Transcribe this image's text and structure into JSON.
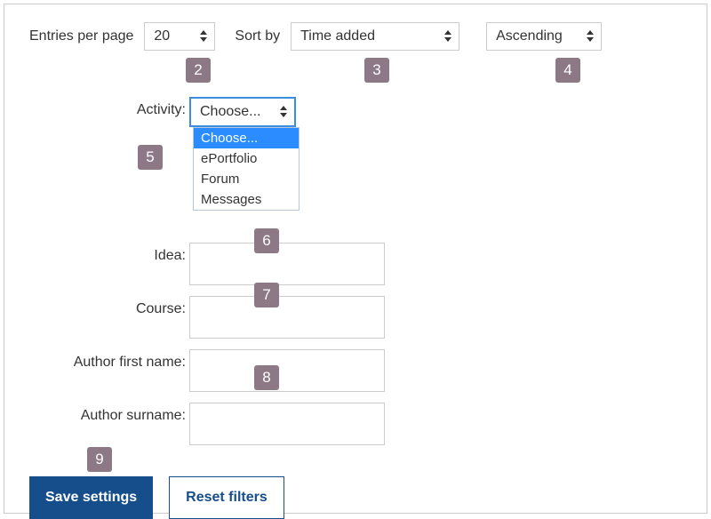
{
  "top": {
    "entries_label": "Entries per page",
    "entries_value": "20",
    "sort_label": "Sort by",
    "sort_value": "Time added",
    "order_value": "Ascending"
  },
  "labels": {
    "activity": "Activity:",
    "idea": "Idea:",
    "course": "Course:",
    "author_first": "Author first name:",
    "author_surname": "Author surname:"
  },
  "activity": {
    "selected": "Choose...",
    "options": [
      "Choose...",
      "ePortfolio",
      "Forum",
      "Messages"
    ]
  },
  "buttons": {
    "save": "Save settings",
    "reset": "Reset filters"
  },
  "badges": {
    "b2": "2",
    "b3": "3",
    "b4": "4",
    "b5": "5",
    "b6": "6",
    "b7": "7",
    "b8": "8",
    "b9": "9"
  }
}
